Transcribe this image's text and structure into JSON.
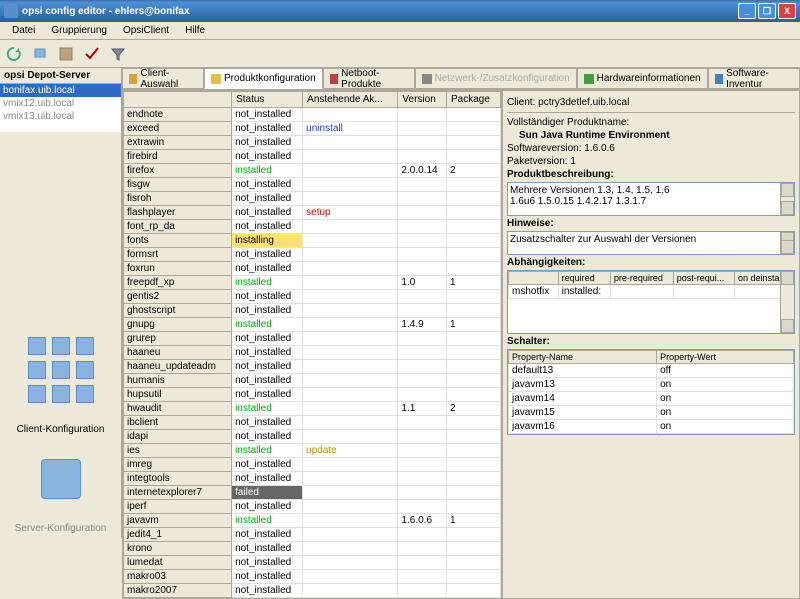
{
  "window": {
    "title": "opsi config editor  -  ehlers@bonifax"
  },
  "menu": [
    "Datei",
    "Gruppierung",
    "OpsiClient",
    "Hilfe"
  ],
  "depot_label": "opsi Depot-Server",
  "servers": [
    "bonifax.uib.local",
    "vmix12.uib.local",
    "vmix13.uib.local"
  ],
  "left_labels": {
    "client": "Client-Konfiguration",
    "server": "Server-Konfiguration"
  },
  "tabs": [
    {
      "label": "Client-Auswahl"
    },
    {
      "label": "Produktkonfiguration",
      "active": true
    },
    {
      "label": "Netboot-Produkte"
    },
    {
      "label": "Netzwerk-/Zusatzkonfiguration",
      "dim": true
    },
    {
      "label": "Hardwareinformationen"
    },
    {
      "label": "Software-Inventur"
    }
  ],
  "table": {
    "headers": [
      "",
      "Status",
      "Anstehende Ak...",
      "Version",
      "Package"
    ],
    "rows": [
      {
        "n": "endnote",
        "s": "not_installed"
      },
      {
        "n": "exceed",
        "s": "not_installed",
        "a": "uninstall"
      },
      {
        "n": "extrawin",
        "s": "not_installed"
      },
      {
        "n": "firebird",
        "s": "not_installed"
      },
      {
        "n": "firefox",
        "s": "installed",
        "v": "2.0.0.14",
        "p": "2"
      },
      {
        "n": "fisgw",
        "s": "not_installed"
      },
      {
        "n": "fisroh",
        "s": "not_installed"
      },
      {
        "n": "flashplayer",
        "s": "not_installed",
        "a": "setup"
      },
      {
        "n": "font_rp_da",
        "s": "not_installed"
      },
      {
        "n": "fonts",
        "s": "installing"
      },
      {
        "n": "formsrt",
        "s": "not_installed"
      },
      {
        "n": "foxrun",
        "s": "not_installed"
      },
      {
        "n": "freepdf_xp",
        "s": "installed",
        "v": "1.0",
        "p": "1"
      },
      {
        "n": "gentis2",
        "s": "not_installed"
      },
      {
        "n": "ghostscript",
        "s": "not_installed"
      },
      {
        "n": "gnupg",
        "s": "installed",
        "v": "1.4.9",
        "p": "1"
      },
      {
        "n": "grurep",
        "s": "not_installed"
      },
      {
        "n": "haaneu",
        "s": "not_installed"
      },
      {
        "n": "haaneu_updateadm",
        "s": "not_installed"
      },
      {
        "n": "humanis",
        "s": "not_installed"
      },
      {
        "n": "hupsutil",
        "s": "not_installed"
      },
      {
        "n": "hwaudit",
        "s": "installed",
        "v": "1.1",
        "p": "2"
      },
      {
        "n": "ibclient",
        "s": "not_installed"
      },
      {
        "n": "idapi",
        "s": "not_installed"
      },
      {
        "n": "ies",
        "s": "installed",
        "a": "update"
      },
      {
        "n": "imreg",
        "s": "not_installed"
      },
      {
        "n": "integtools",
        "s": "not_installed"
      },
      {
        "n": "internetexplorer7",
        "s": "failed"
      },
      {
        "n": "iperf",
        "s": "not_installed"
      },
      {
        "n": "javavm",
        "s": "installed",
        "v": "1.6.0.6",
        "p": "1"
      },
      {
        "n": "jedit4_1",
        "s": "not_installed"
      },
      {
        "n": "krono",
        "s": "not_installed"
      },
      {
        "n": "lumedat",
        "s": "not_installed"
      },
      {
        "n": "makro03",
        "s": "not_installed"
      },
      {
        "n": "makro2007",
        "s": "not_installed"
      }
    ]
  },
  "details": {
    "client_label": "Client:",
    "client": "pctry3detlef.uib.local",
    "fullname_label": "Vollständiger Produktname:",
    "fullname": "Sun Java Runtime Environment",
    "swver_label": "Softwareversion:",
    "swver": "1.6.0.6",
    "pkgver_label": "Paketversion:",
    "pkgver": "1",
    "desc_label": "Produktbeschreibung:",
    "desc": "Mehrere Versionen 1.3, 1.4, 1.5, 1.6\n1.6u6 1.5.0.15 1.4.2.17 1.3.1.7",
    "hints_label": "Hinweise:",
    "hints": "Zusatzschalter zur Auswahl der Versionen",
    "deps_label": "Abhängigkeiten:",
    "deps_headers": [
      "",
      "required",
      "pre-required",
      "post-requi...",
      "on deinstall"
    ],
    "deps_row": {
      "name": "mshotfix",
      "required": "installed:"
    },
    "props_label": "Schalter:",
    "props_headers": [
      "Property-Name",
      "Property-Wert"
    ],
    "props": [
      {
        "n": "default13",
        "v": "off"
      },
      {
        "n": "javavm13",
        "v": "on"
      },
      {
        "n": "javavm14",
        "v": "on"
      },
      {
        "n": "javavm15",
        "v": "on"
      },
      {
        "n": "javavm16",
        "v": "on"
      }
    ]
  }
}
